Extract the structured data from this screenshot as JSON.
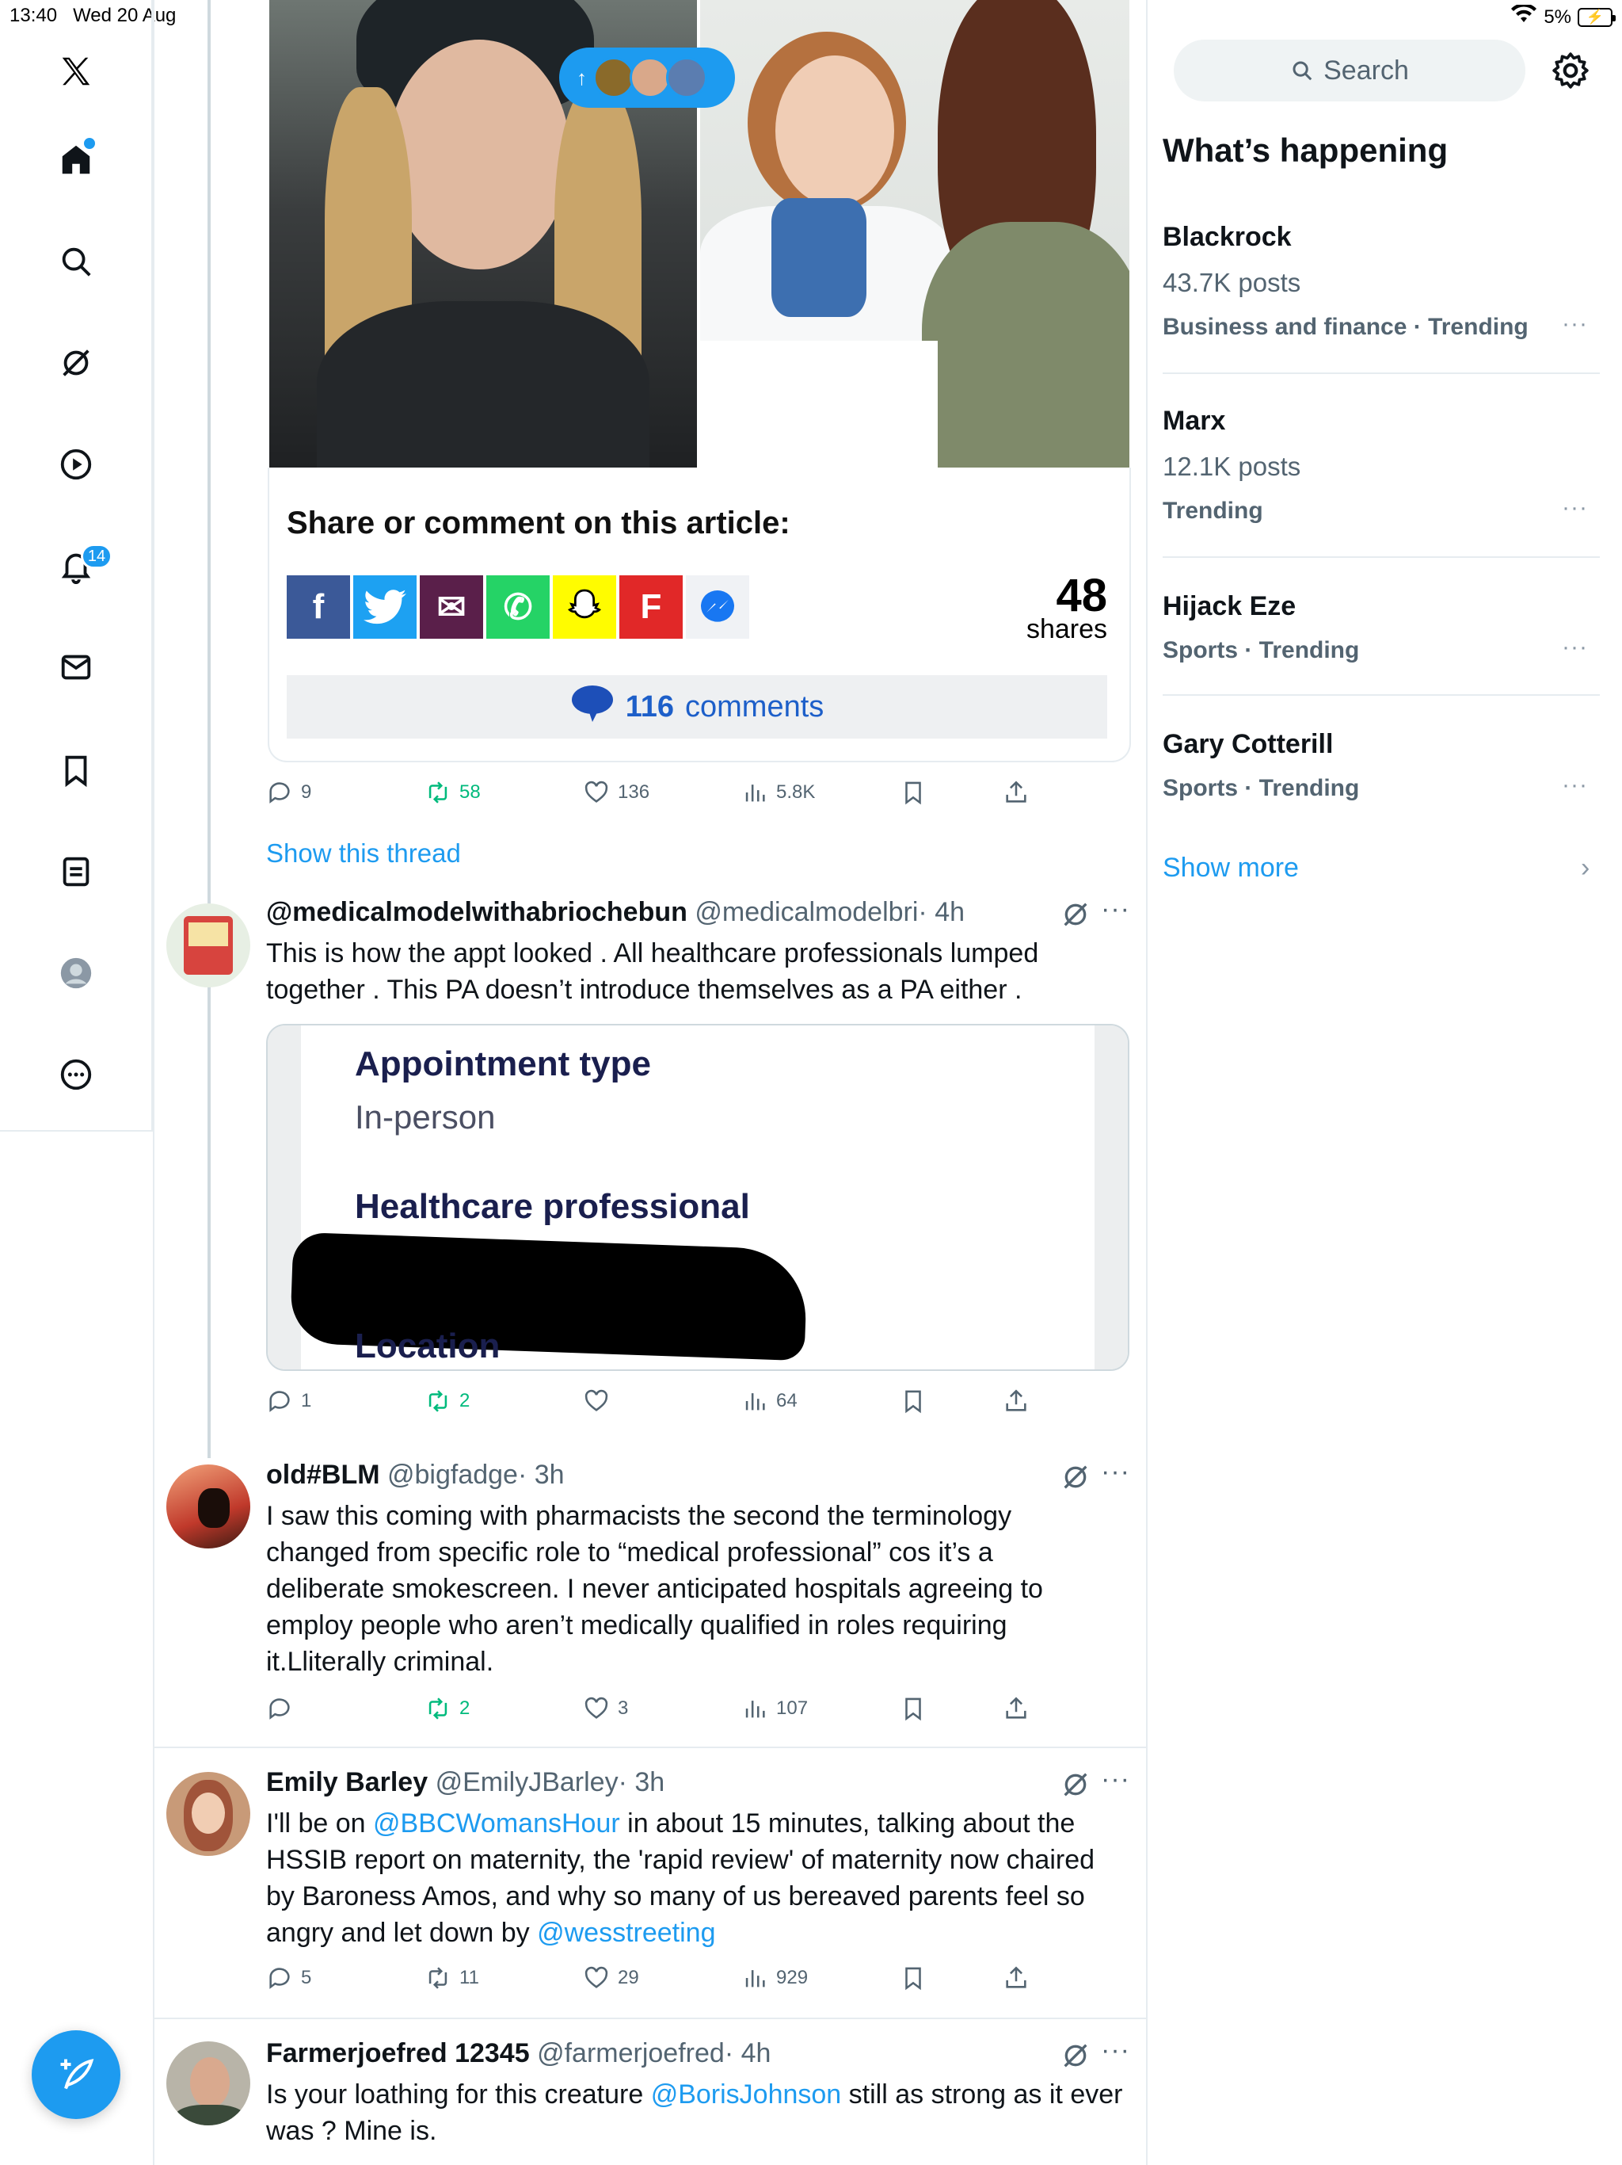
{
  "status_bar": {
    "time": "13:40",
    "date": "Wed 20 Aug",
    "battery": "5%"
  },
  "nav": {
    "logo": "x-logo-icon",
    "items": [
      "home-icon",
      "search-icon",
      "grok-icon",
      "video-icon",
      "notifications-icon",
      "messages-icon",
      "bookmarks-icon",
      "lists-icon",
      "profile-icon",
      "more-icon"
    ],
    "notifications_badge": "14"
  },
  "new_posts_pill": {
    "arrow": "↑"
  },
  "article_card": {
    "share_title": "Share or comment on this article:",
    "share_buttons": [
      {
        "label": "f",
        "color": "#3b5998",
        "icon": "facebook-icon"
      },
      {
        "label": "t",
        "color": "#1da1f2",
        "icon": "twitter-icon"
      },
      {
        "label": "✉",
        "color": "#5a1f4a",
        "icon": "email-icon"
      },
      {
        "label": "✆",
        "color": "#25d366",
        "icon": "whatsapp-icon"
      },
      {
        "label": "👻",
        "color": "#fffc00",
        "icon": "snapchat-icon"
      },
      {
        "label": "F",
        "color": "#e12828",
        "icon": "flipboard-icon"
      },
      {
        "label": "m",
        "color": "#f0f2f5",
        "icon": "messenger-icon"
      }
    ],
    "shares_count": "48",
    "shares_label": "shares",
    "comments_count": "116",
    "comments_label": "comments"
  },
  "first_actions": {
    "replies": "9",
    "reposts": "58",
    "likes": "136",
    "views": "5.8K"
  },
  "show_thread": "Show this thread",
  "tweets": [
    {
      "name": "@medicalmodelwithabriochebun",
      "handle": "@medicalmodelbri",
      "time": "· 4h",
      "text": "This is how the appt looked . All healthcare professionals lumped together . This PA doesn’t introduce themselves as a PA either .",
      "actions": {
        "replies": "1",
        "reposts": "2",
        "likes": "",
        "views": "64"
      }
    },
    {
      "name": "old#BLM",
      "handle": "@bigfadge",
      "time": "· 3h",
      "text": "I saw this coming with pharmacists the second the terminology changed from specific role to “medical professional” cos it’s a deliberate smokescreen. I never anticipated hospitals agreeing to employ people who aren’t medically qualified in roles requiring it.Lliterally criminal.",
      "actions": {
        "replies": "",
        "reposts": "2",
        "likes": "3",
        "views": "107"
      }
    },
    {
      "name": "Emily Barley",
      "handle": "@EmilyJBarley",
      "time": "· 3h",
      "text_pre": "I'll be on ",
      "mention1": "@BBCWomansHour",
      "text_mid": " in about 15 minutes, talking about the HSSIB report on maternity, the 'rapid review' of maternity now chaired by Baroness Amos, and why so many of us bereaved parents feel so angry and let down by ",
      "mention2": "@wesstreeting",
      "actions": {
        "replies": "5",
        "reposts": "11",
        "likes": "29",
        "views": "929"
      }
    },
    {
      "name": "Farmerjoefred 12345",
      "handle": "@farmerjoefred",
      "time": "· 4h",
      "text_pre": "Is your loathing for this creature ",
      "mention1": "@BorisJohnson",
      "text_post": " still as strong as it ever was ?  Mine is."
    }
  ],
  "appointment_card": {
    "type_label": "Appointment type",
    "type_value": "In-person",
    "professional_label": "Healthcare professional",
    "location_label": "Location"
  },
  "sidebar": {
    "search_placeholder": "Search",
    "section_title": "What’s happening",
    "trends": [
      {
        "title": "Blackrock",
        "posts": "43.7K posts",
        "meta": "Business and finance · Trending"
      },
      {
        "title": "Marx",
        "posts": "12.1K posts",
        "meta": "Trending"
      },
      {
        "title": "Hijack Eze",
        "posts": "",
        "meta": "Sports · Trending"
      },
      {
        "title": "Gary Cotterill",
        "posts": "",
        "meta": "Sports · Trending"
      }
    ],
    "show_more": "Show more"
  },
  "colors": {
    "accent": "#1d9bf0",
    "repost_green": "#00ba7c",
    "text_secondary": "#536471"
  }
}
